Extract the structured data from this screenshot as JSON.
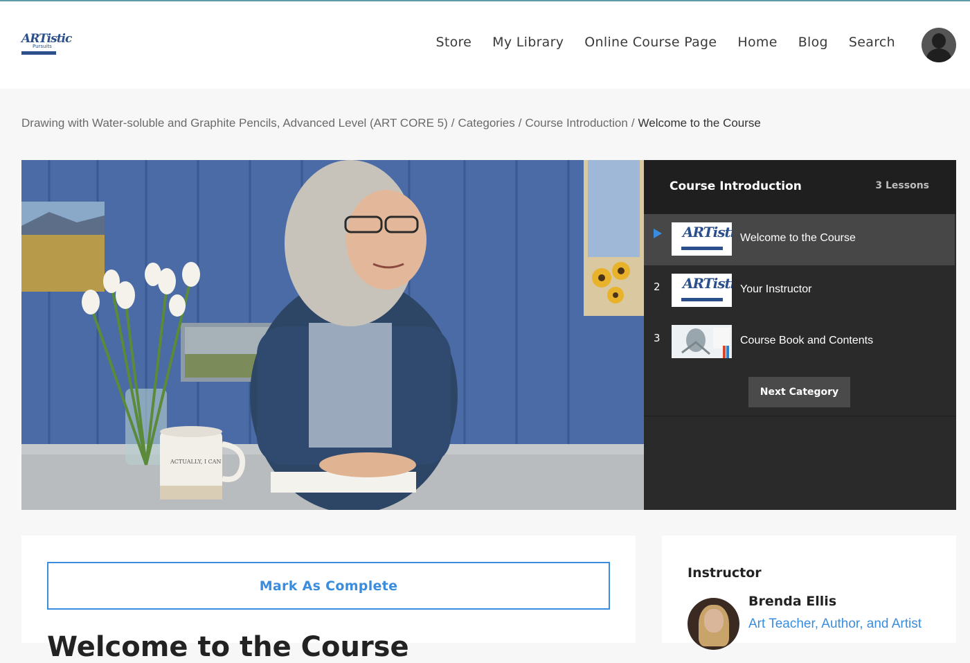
{
  "header": {
    "logo_text": "ARTistic",
    "logo_sub": "Pursuits",
    "nav": [
      "Store",
      "My Library",
      "Online Course Page",
      "Home",
      "Blog",
      "Search"
    ]
  },
  "breadcrumb": {
    "items": [
      "Drawing with Water-soluble and Graphite Pencils, Advanced Level (ART CORE 5)",
      "Categories",
      "Course Introduction"
    ],
    "current": "Welcome to the Course",
    "separator": "/"
  },
  "video": {
    "mug_text": "ACTUALLY, I CAN"
  },
  "sidebar": {
    "title": "Course Introduction",
    "count": "3 Lessons",
    "lessons": [
      {
        "num": "",
        "label": "Welcome to the Course",
        "thumb": "ARTistic"
      },
      {
        "num": "2",
        "label": "Your Instructor",
        "thumb": "ARTistic"
      },
      {
        "num": "3",
        "label": "Course Book and Contents",
        "thumb": ""
      }
    ],
    "next_button": "Next Category"
  },
  "main": {
    "mark_complete": "Mark As Complete",
    "heading": "Welcome to the Course"
  },
  "instructor": {
    "title": "Instructor",
    "name": "Brenda Ellis",
    "role": "Art Teacher, Author, and Artist"
  },
  "colors": {
    "accent": "#3a8dde",
    "sidebar_bg": "#2a2a2a",
    "active_lesson": "#474747"
  }
}
